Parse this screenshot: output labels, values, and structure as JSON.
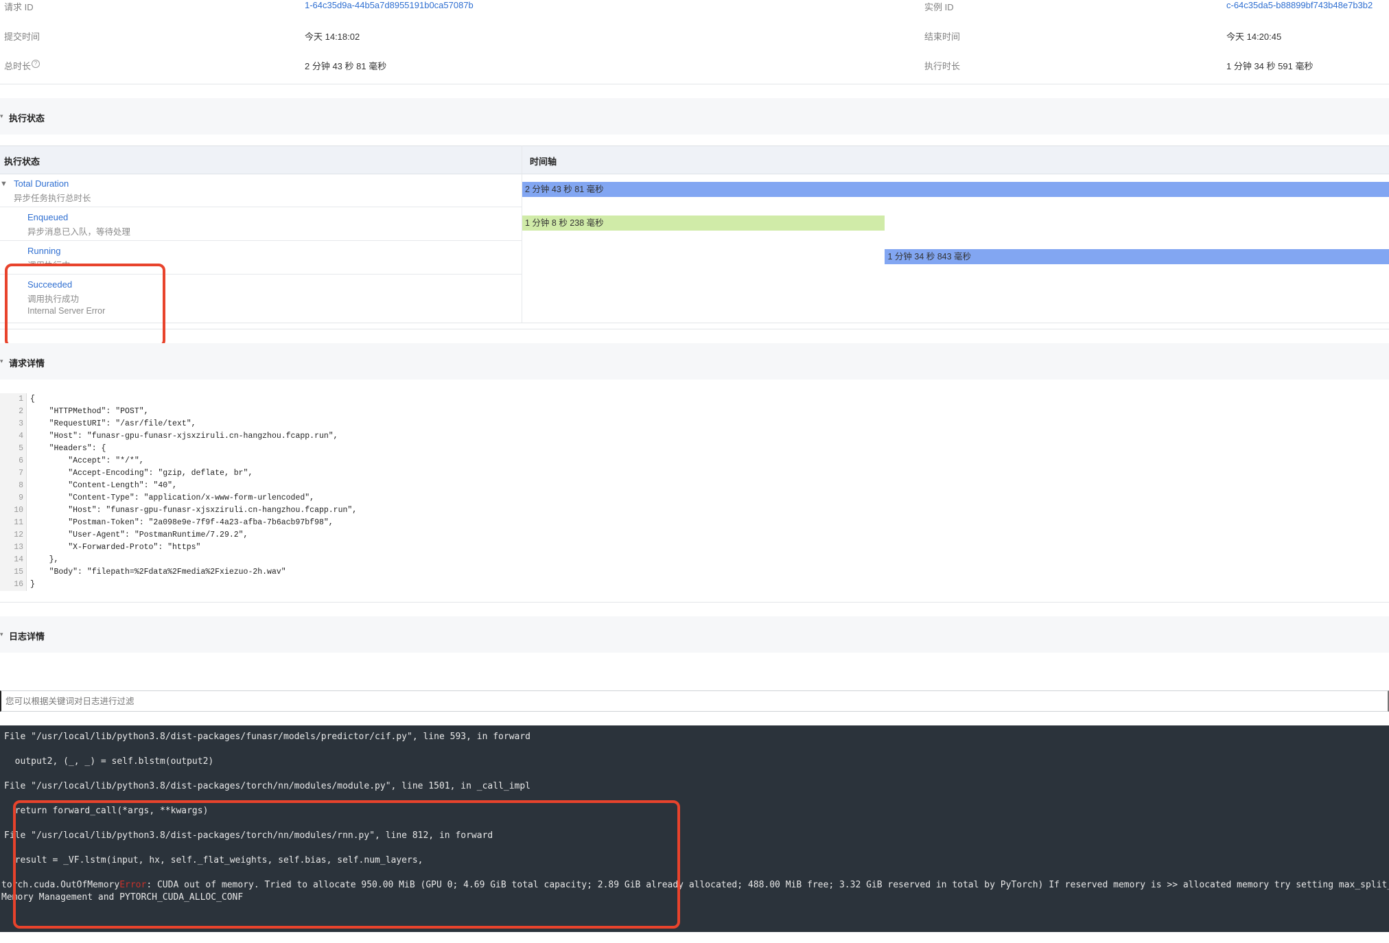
{
  "info": {
    "left": [
      {
        "label": "请求 ID",
        "value": "1-64c35d9a-44b5a7d8955191b0ca57087b",
        "is_link": true
      },
      {
        "label": "提交时间",
        "value": "今天 14:18:02",
        "is_link": false
      },
      {
        "label": "总时长",
        "value": "2 分钟 43 秒 81 毫秒",
        "is_link": false,
        "help_icon": "question-circle-icon"
      }
    ],
    "right": [
      {
        "label": "实例 ID",
        "value": "c-64c35da5-b88899bf743b48e7b3b2",
        "is_link": true
      },
      {
        "label": "结束时间",
        "value": "今天 14:20:45",
        "is_link": false
      },
      {
        "label": "执行时长",
        "value": "1 分钟 34 秒 591 毫秒",
        "is_link": false
      }
    ]
  },
  "sections": {
    "status": "执行状态",
    "request": "请求详情",
    "logs": "日志详情"
  },
  "status_table": {
    "col_status": "执行状态",
    "col_timeline": "时间轴",
    "total_ms": 163081,
    "rows": [
      {
        "name": "Total Duration",
        "desc": "异步任务执行总时长",
        "extra": "",
        "expandable": true,
        "bar_label": "2 分钟 43 秒 81 毫秒",
        "bar_start_ms": 0,
        "bar_ms": 163081,
        "bar_color": "#82a6f2"
      },
      {
        "name": "Enqueued",
        "desc": "异步消息已入队，等待处理",
        "extra": "",
        "expandable": false,
        "bar_label": "1 分钟 8 秒 238 毫秒",
        "bar_start_ms": 0,
        "bar_ms": 68238,
        "bar_color": "#d0eba8"
      },
      {
        "name": "Running",
        "desc": "调用执行中",
        "extra": "",
        "expandable": false,
        "bar_label": "1 分钟 34 秒 843 毫秒",
        "bar_start_ms": 68238,
        "bar_ms": 94843,
        "bar_color": "#82a6f2"
      },
      {
        "name": "Succeeded",
        "desc": "调用执行成功",
        "extra": "Internal Server Error",
        "expandable": false,
        "bar_label": "",
        "bar_start_ms": null,
        "bar_ms": null,
        "bar_color": ""
      }
    ]
  },
  "request_json_lines": [
    "{",
    "    \"HTTPMethod\": \"POST\",",
    "    \"RequestURI\": \"/asr/file/text\",",
    "    \"Host\": \"funasr-gpu-funasr-xjsxziruli.cn-hangzhou.fcapp.run\",",
    "    \"Headers\": {",
    "        \"Accept\": \"*/*\",",
    "        \"Accept-Encoding\": \"gzip, deflate, br\",",
    "        \"Content-Length\": \"40\",",
    "        \"Content-Type\": \"application/x-www-form-urlencoded\",",
    "        \"Host\": \"funasr-gpu-funasr-xjsxziruli.cn-hangzhou.fcapp.run\",",
    "        \"Postman-Token\": \"2a098e9e-7f9f-4a23-afba-7b6acb97bf98\",",
    "        \"User-Agent\": \"PostmanRuntime/7.29.2\",",
    "        \"X-Forwarded-Proto\": \"https\"",
    "    },",
    "    \"Body\": \"filepath=%2Fdata%2Fmedia%2Fxiezuo-2h.wav\"",
    "}"
  ],
  "log_filter": {
    "placeholder": "您可以根据关键词对日志进行过滤",
    "value": ""
  },
  "log_lines": [
    "File \"/usr/local/lib/python3.8/dist-packages/funasr/models/predictor/cif.py\", line 593, in forward",
    "  output2, (_, _) = self.blstm(output2)",
    "File \"/usr/local/lib/python3.8/dist-packages/torch/nn/modules/module.py\", line 1501, in _call_impl",
    "  return forward_call(*args, **kwargs)",
    "File \"/usr/local/lib/python3.8/dist-packages/torch/nn/modules/rnn.py\", line 812, in forward",
    "  result = _VF.lstm(input, hx, self._flat_weights, self.bias, self.num_layers,"
  ],
  "log_error": {
    "prefix": "torch.cuda.OutOfMemory",
    "keyword": "Error",
    "message": ": CUDA out of memory. Tried to allocate 950.00 MiB (GPU 0; 4.69 GiB total capacity; 2.89 GiB already allocated; 488.00 MiB free; 3.32 GiB reserved in total by PyTorch) If reserved memory is >> allocated memory try setting max_split_size_mb to avoid fragmentation.  See documentation for",
    "continuation": "Memory Management and PYTORCH_CUDA_ALLOC_CONF"
  },
  "colors": {
    "link": "#2f6fd1",
    "highlight_box": "#e8432c",
    "log_bg": "#2b333b",
    "error_keyword": "#c8322b"
  }
}
